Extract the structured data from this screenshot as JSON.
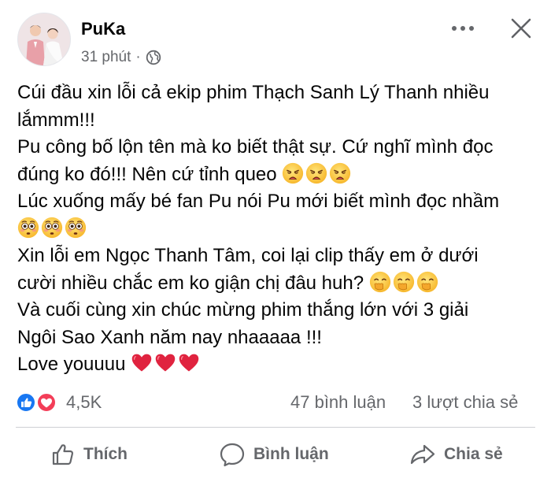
{
  "header": {
    "author": "PuKa",
    "time": "31 phút",
    "separator": "·",
    "privacy_icon": "globe-icon"
  },
  "post": {
    "lines": [
      "Cúi đầu xin lỗi cả ekip phim Thạch Sanh Lý Thanh nhiều",
      "lắmmm!!!",
      "Pu công bố lộn tên mà ko biết thật sự. Cứ nghĩ mình đọc",
      "đúng ko đó!!! Nên cứ tỉnh queo",
      "Lúc xuống mấy bé fan Pu nói Pu mới biết mình đọc nhầm",
      "",
      "Xin lỗi em Ngọc Thanh Tâm, coi lại clip thấy em ở dưới",
      "cười nhiều chắc em ko giận chị đâu huh?",
      "Và cuối cùng xin chúc mừng phim thắng lớn với 3 giải",
      "Ngôi Sao Xanh năm nay nhaaaaa !!!",
      "Love youuuu"
    ],
    "emoji": {
      "weary": "weary-face-emoji",
      "flushed": "flushed-face-emoji",
      "hand_over_mouth": "face-with-hand-over-mouth-emoji",
      "heart": "red-heart-emoji"
    }
  },
  "stats": {
    "reaction_count": "4,5K",
    "comments": "47 bình luận",
    "shares": "3 lượt chia sẻ"
  },
  "actions": {
    "like": "Thích",
    "comment": "Bình luận",
    "share": "Chia sẻ"
  },
  "colors": {
    "text": "#050505",
    "secondary": "#65676b",
    "like_blue": "#1877f2",
    "love_red": "#f33e58",
    "divider": "#ced0d4"
  }
}
